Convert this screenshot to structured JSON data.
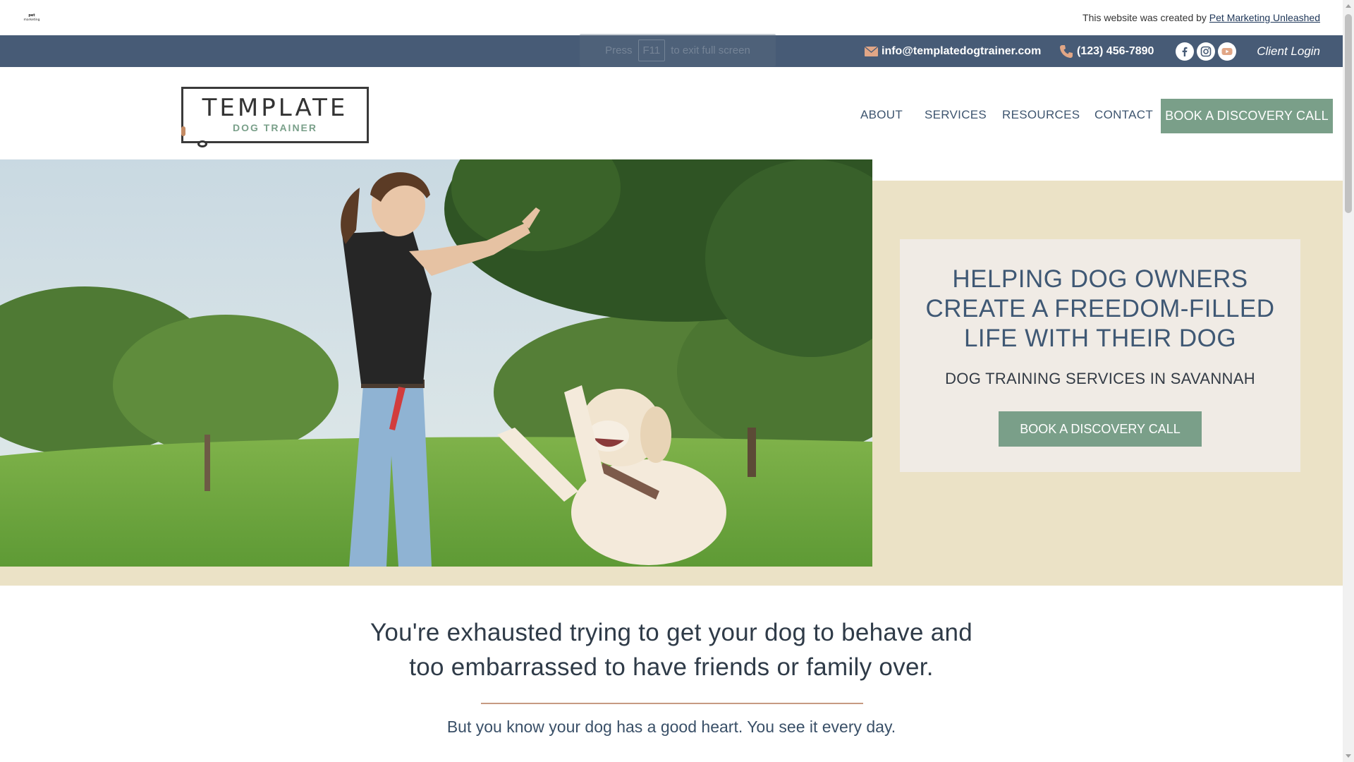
{
  "credit": {
    "prefix": "This website was created by",
    "link": "Pet Marketing Unleashed",
    "mini_logo": "pet marketing"
  },
  "contact": {
    "email": "info@templatedogtrainer.com",
    "phone": "(123) 456-7890",
    "client_login": "Client Login",
    "socials": [
      "facebook-icon",
      "instagram-icon",
      "youtube-icon"
    ]
  },
  "fullscreen_hint": {
    "press": "Press",
    "key": "F11",
    "rest": "to exit full screen"
  },
  "logo": {
    "title": "TEMPLATE",
    "subtitle": "DOG TRAINER"
  },
  "nav": {
    "items": [
      "ABOUT",
      "SERVICES",
      "RESOURCES",
      "CONTACT"
    ],
    "cta": "BOOK A DISCOVERY CALL"
  },
  "hero": {
    "title": "HELPING DOG OWNERS CREATE A FREEDOM-FILLED LIFE WITH THEIR DOG",
    "subtitle": "DOG TRAINING SERVICES IN SAVANNAH",
    "cta": "BOOK A DISCOVERY CALL"
  },
  "intro": {
    "headline_line1": "You're exhausted trying to get your dog to behave and",
    "headline_line2": "too embarrassed to have friends or family over.",
    "subline": "But you know your dog has a good heart. You see it every day."
  },
  "colors": {
    "contact_bar": "#475b76",
    "accent_green": "#7a9f89",
    "hero_bg": "#ebe2c6",
    "card_bg": "#f0ebe5",
    "divider": "#c79a82"
  }
}
